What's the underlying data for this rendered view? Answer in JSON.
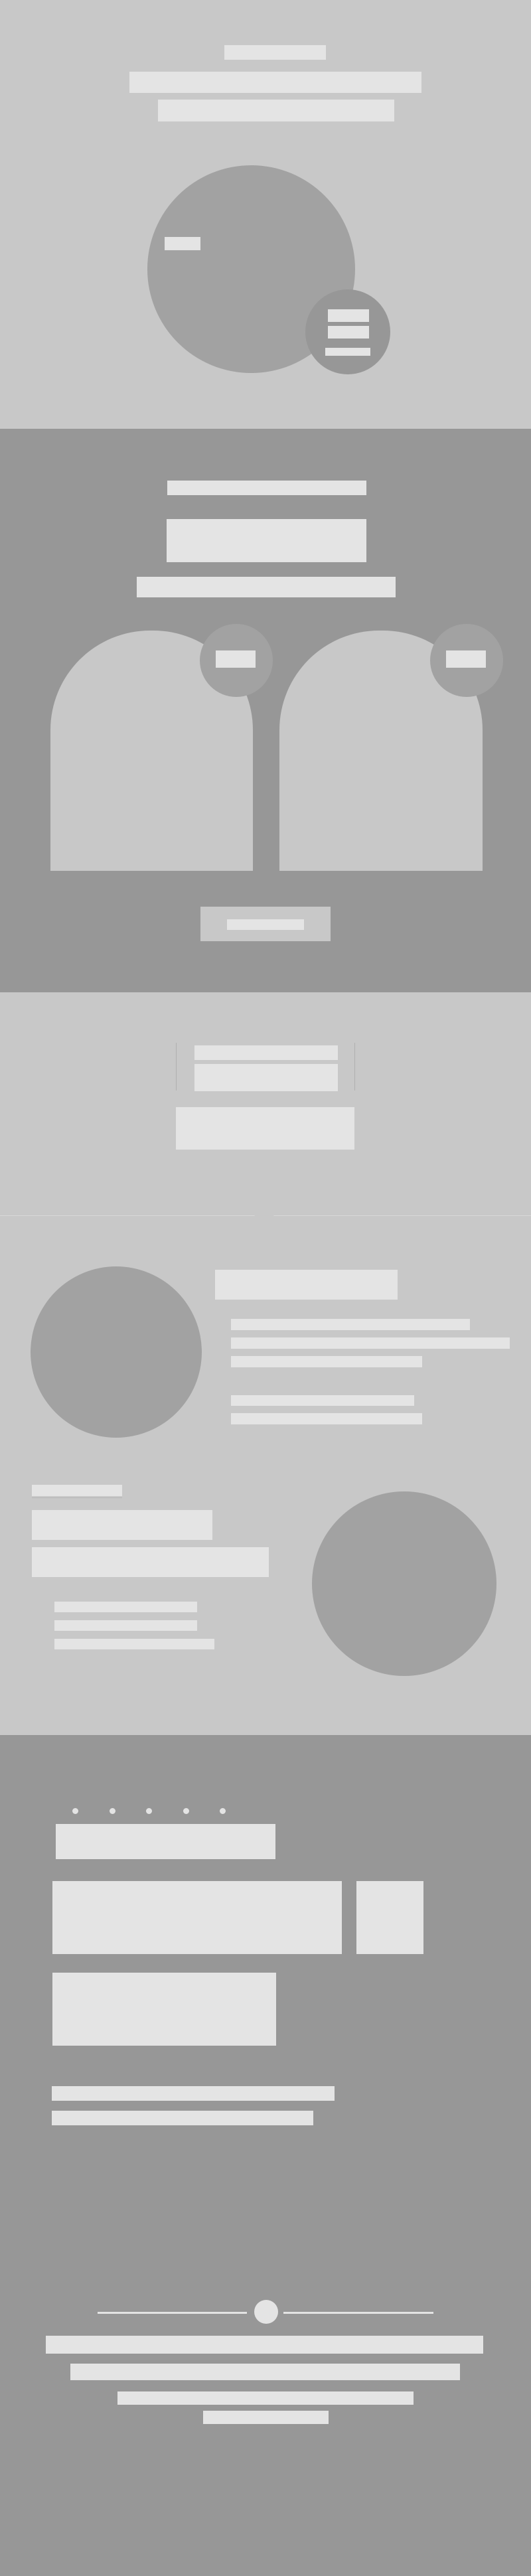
{
  "sections": [
    {
      "name": "hero",
      "background": "#c8c8c8",
      "note": ""
    },
    {
      "name": "cards",
      "background": "#979797",
      "note": ""
    },
    {
      "name": "cta",
      "background": "#c8c8c8",
      "note": ""
    },
    {
      "name": "features",
      "background": "#c8c8c8",
      "note": ""
    },
    {
      "name": "content",
      "background": "#979797",
      "note": ""
    },
    {
      "name": "footer",
      "background": "#979797",
      "note": ""
    }
  ],
  "colors": {
    "light_bg": "#c8c8c8",
    "dark_bg": "#979797",
    "placeholder": "#e4e4e4",
    "shape": "#a2a2a2"
  },
  "placeholders": {
    "hero_kicker": "",
    "hero_title": "",
    "hero_subtitle": "",
    "hero_badge": "",
    "cards_kicker": "",
    "cards_title": "",
    "cards_subtitle": "",
    "cards_button": "",
    "cta_title_1": "",
    "cta_title_2": "",
    "cta_button": "",
    "feature1_title": "",
    "feature2_title": "",
    "content_title": "",
    "footer_1": "",
    "footer_2": "",
    "footer_3": "",
    "footer_4": ""
  },
  "content_dots_count": 5
}
